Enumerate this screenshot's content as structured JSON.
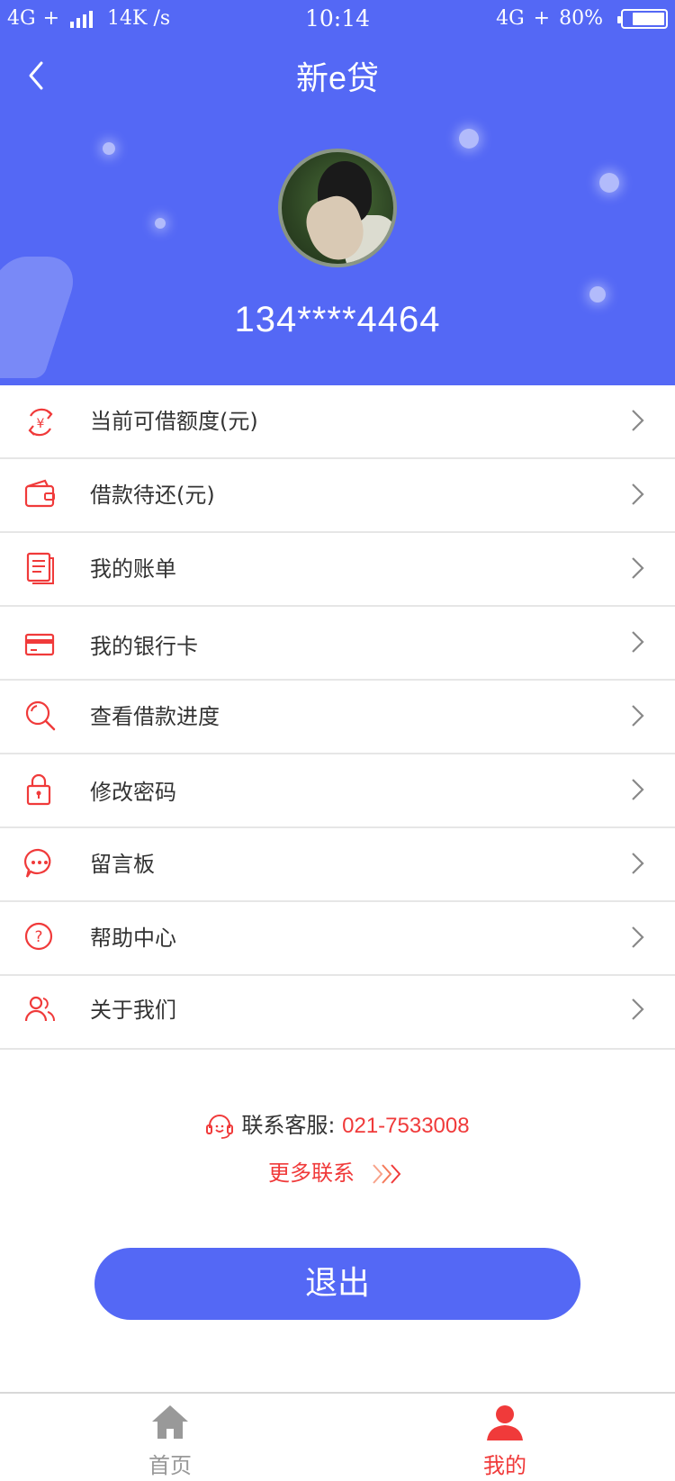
{
  "status_bar": {
    "network_left": "4G",
    "speed": "14K /s",
    "time": "10:14",
    "network_right": "4G",
    "battery": "80%",
    "battery_level": 0.8
  },
  "header": {
    "title": "新e贷",
    "phone": "134****4464"
  },
  "menu": {
    "items": [
      {
        "label": "当前可借额度(元)",
        "icon": "yuan-refresh-icon"
      },
      {
        "label": "借款待还(元)",
        "icon": "wallet-icon"
      },
      {
        "label": "我的账单",
        "icon": "bill-icon"
      },
      {
        "label": "我的银行卡",
        "icon": "bank-card-icon"
      },
      {
        "label": "查看借款进度",
        "icon": "search-icon"
      },
      {
        "label": "修改密码",
        "icon": "lock-icon"
      },
      {
        "label": "留言板",
        "icon": "message-icon"
      },
      {
        "label": "帮助中心",
        "icon": "help-icon"
      },
      {
        "label": "关于我们",
        "icon": "users-icon"
      }
    ]
  },
  "contact": {
    "label": "联系客服:",
    "phone": "021-7533008",
    "more": "更多联系"
  },
  "logout_label": "退出",
  "tabbar": {
    "home": "首页",
    "mine": "我的"
  },
  "colors": {
    "primary": "#5468f5",
    "accent": "#f03a3a",
    "inactive": "#999999"
  }
}
